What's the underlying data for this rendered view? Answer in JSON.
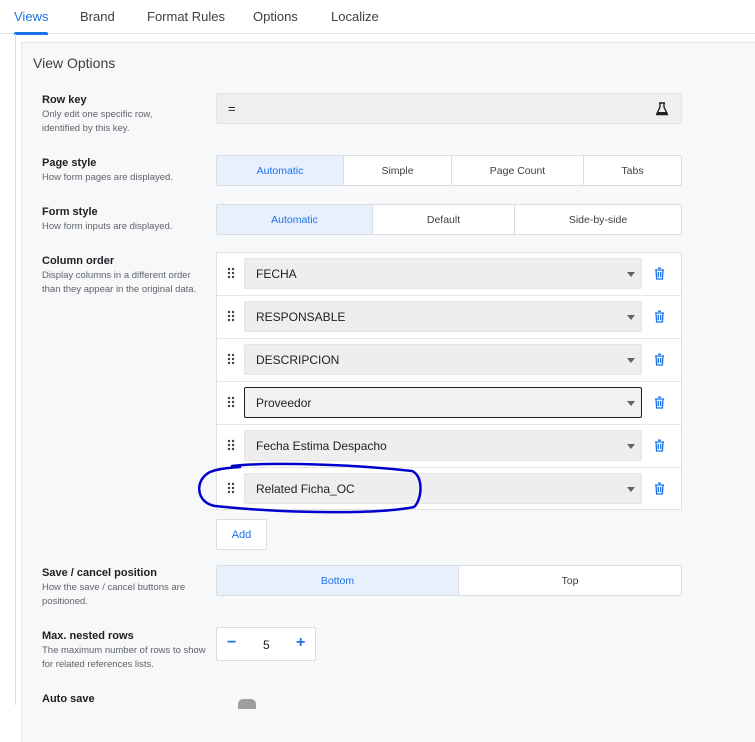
{
  "tabs": [
    {
      "label": "Views",
      "active": true
    },
    {
      "label": "Brand",
      "active": false
    },
    {
      "label": "Format Rules",
      "active": false
    },
    {
      "label": "Options",
      "active": false
    },
    {
      "label": "Localize",
      "active": false
    }
  ],
  "section_title": "View Options",
  "row_key": {
    "title": "Row key",
    "description": "Only edit one specific row, identified by this key.",
    "value": "=",
    "icon": "flask-icon"
  },
  "page_style": {
    "title": "Page style",
    "description": "How form pages are displayed.",
    "options": [
      "Automatic",
      "Simple",
      "Page Count",
      "Tabs"
    ],
    "selected": "Automatic"
  },
  "form_style": {
    "title": "Form style",
    "description": "How form inputs are displayed.",
    "options": [
      "Automatic",
      "Default",
      "Side-by-side"
    ],
    "selected": "Automatic"
  },
  "column_order": {
    "title": "Column order",
    "description": "Display columns in a different order than they appear in the original data.",
    "columns": [
      "FECHA",
      "RESPONSABLE",
      "DESCRIPCION",
      "Proveedor",
      "Fecha Estima Despacho",
      "Related Ficha_OC"
    ],
    "focused": "Proveedor",
    "add_label": "Add"
  },
  "save_cancel_position": {
    "title": "Save / cancel position",
    "description": "How the save / cancel buttons are positioned.",
    "options": [
      "Bottom",
      "Top"
    ],
    "selected": "Bottom"
  },
  "max_nested_rows": {
    "title": "Max. nested rows",
    "description": "The maximum number of rows to show for related references lists.",
    "value": "5",
    "minus": "−",
    "plus": "+"
  },
  "auto_save": {
    "title": "Auto save"
  },
  "colors": {
    "accent": "#1a73e8",
    "annotation": "#0000cc"
  }
}
